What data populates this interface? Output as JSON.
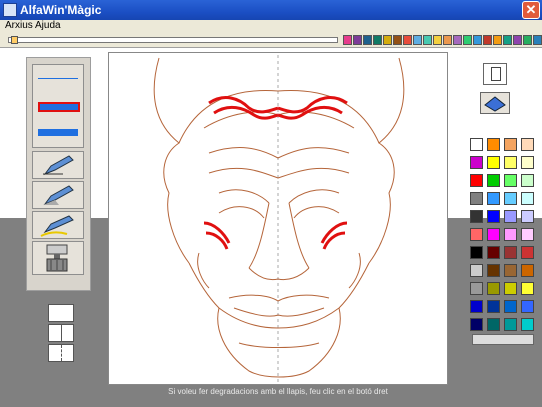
{
  "window": {
    "title": "AlfaWin'Màgic",
    "close_label": "✕"
  },
  "menu": {
    "items": [
      "Arxius",
      "Ajuda"
    ]
  },
  "toolbar": {
    "strip_colors": [
      "#e63c8c",
      "#7d3c98",
      "#1f618d",
      "#117a65",
      "#d4ac0d",
      "#935116",
      "#e74c3c",
      "#5dade2",
      "#48c9b0",
      "#f4d03f",
      "#eb984e",
      "#a569bd",
      "#2ecc71",
      "#3498db",
      "#c0392b",
      "#f39c12",
      "#16a085",
      "#8e44ad",
      "#27ae60",
      "#2980b9"
    ]
  },
  "tools": [
    {
      "name": "thin-line-tool"
    },
    {
      "name": "medium-line-tool",
      "selected": true
    },
    {
      "name": "thick-line-tool"
    },
    {
      "name": "pen-tool"
    },
    {
      "name": "pen-fill-tool"
    },
    {
      "name": "pencil-tool"
    },
    {
      "name": "roller-tool"
    }
  ],
  "status": {
    "message": "Si voleu fer degradacions amb el llapis, feu clic en el botó dret"
  },
  "palette": {
    "colors": [
      "#ffffff",
      "#ff8c00",
      "#f4a460",
      "#ffdab9",
      "#cc00cc",
      "#ffff00",
      "#ffff66",
      "#ffffcc",
      "#ff0000",
      "#00cc00",
      "#66ff66",
      "#ccffcc",
      "#808080",
      "#3399ff",
      "#66ccff",
      "#ccffff",
      "#333333",
      "#0000ff",
      "#9999ff",
      "#ccccff",
      "#ff6666",
      "#ff00ff",
      "#ff99ff",
      "#ffccff",
      "#000000",
      "#660000",
      "#993333",
      "#cc3333",
      "#cccccc",
      "#663300",
      "#996633",
      "#cc6600",
      "#999999",
      "#999900",
      "#cccc00",
      "#ffff33",
      "#0000cc",
      "#003399",
      "#0066cc",
      "#3366ff",
      "#000066",
      "#006666",
      "#009999",
      "#00cccc"
    ],
    "selected_color": "#dddddd"
  },
  "colors": {
    "line": "#b5653a",
    "stroke": "#e01010",
    "guide": "#aaaaaa"
  }
}
